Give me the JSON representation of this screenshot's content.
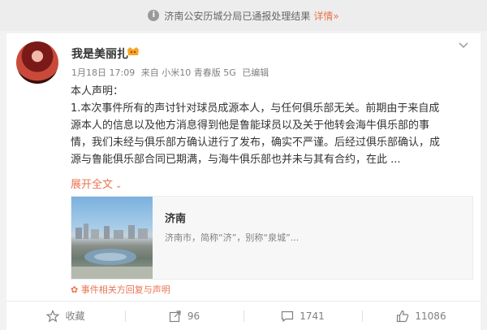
{
  "notice": {
    "text": "济南公安历城分局已通报处理结果",
    "link": "详情»"
  },
  "post": {
    "username": "我是美丽扎",
    "date": "1月18日 17:09",
    "source": "来自 小米10 青春版 5G",
    "edited": "已编辑",
    "lines": [
      "本人声明：",
      "1.本次事件所有的声讨针对球员成源本人，与任何俱乐部无关。前期由于来自成",
      "源本人的信息以及他方消息得到他是鲁能球员以及关于他转会海牛俱乐部的事",
      "情，我们未经与俱乐部方确认进行了发布，确实不严谨。后经过俱乐部确认，成",
      "源与鲁能俱乐部合同已期满，与海牛俱乐部也并未与其有合约，在此 ..."
    ],
    "expand": "展开全文",
    "link_card": {
      "title": "济南",
      "desc": "济南市，简称“济”，别称“泉城”..."
    },
    "related": "事件相关方回复与声明"
  },
  "actions": [
    {
      "label": "收藏",
      "icon": "star-icon"
    },
    {
      "label": "96",
      "icon": "share-icon"
    },
    {
      "label": "1741",
      "icon": "comment-icon"
    },
    {
      "label": "11086",
      "icon": "like-icon"
    }
  ],
  "colors": {
    "accent": "#eb7350",
    "meta": "#808080"
  }
}
